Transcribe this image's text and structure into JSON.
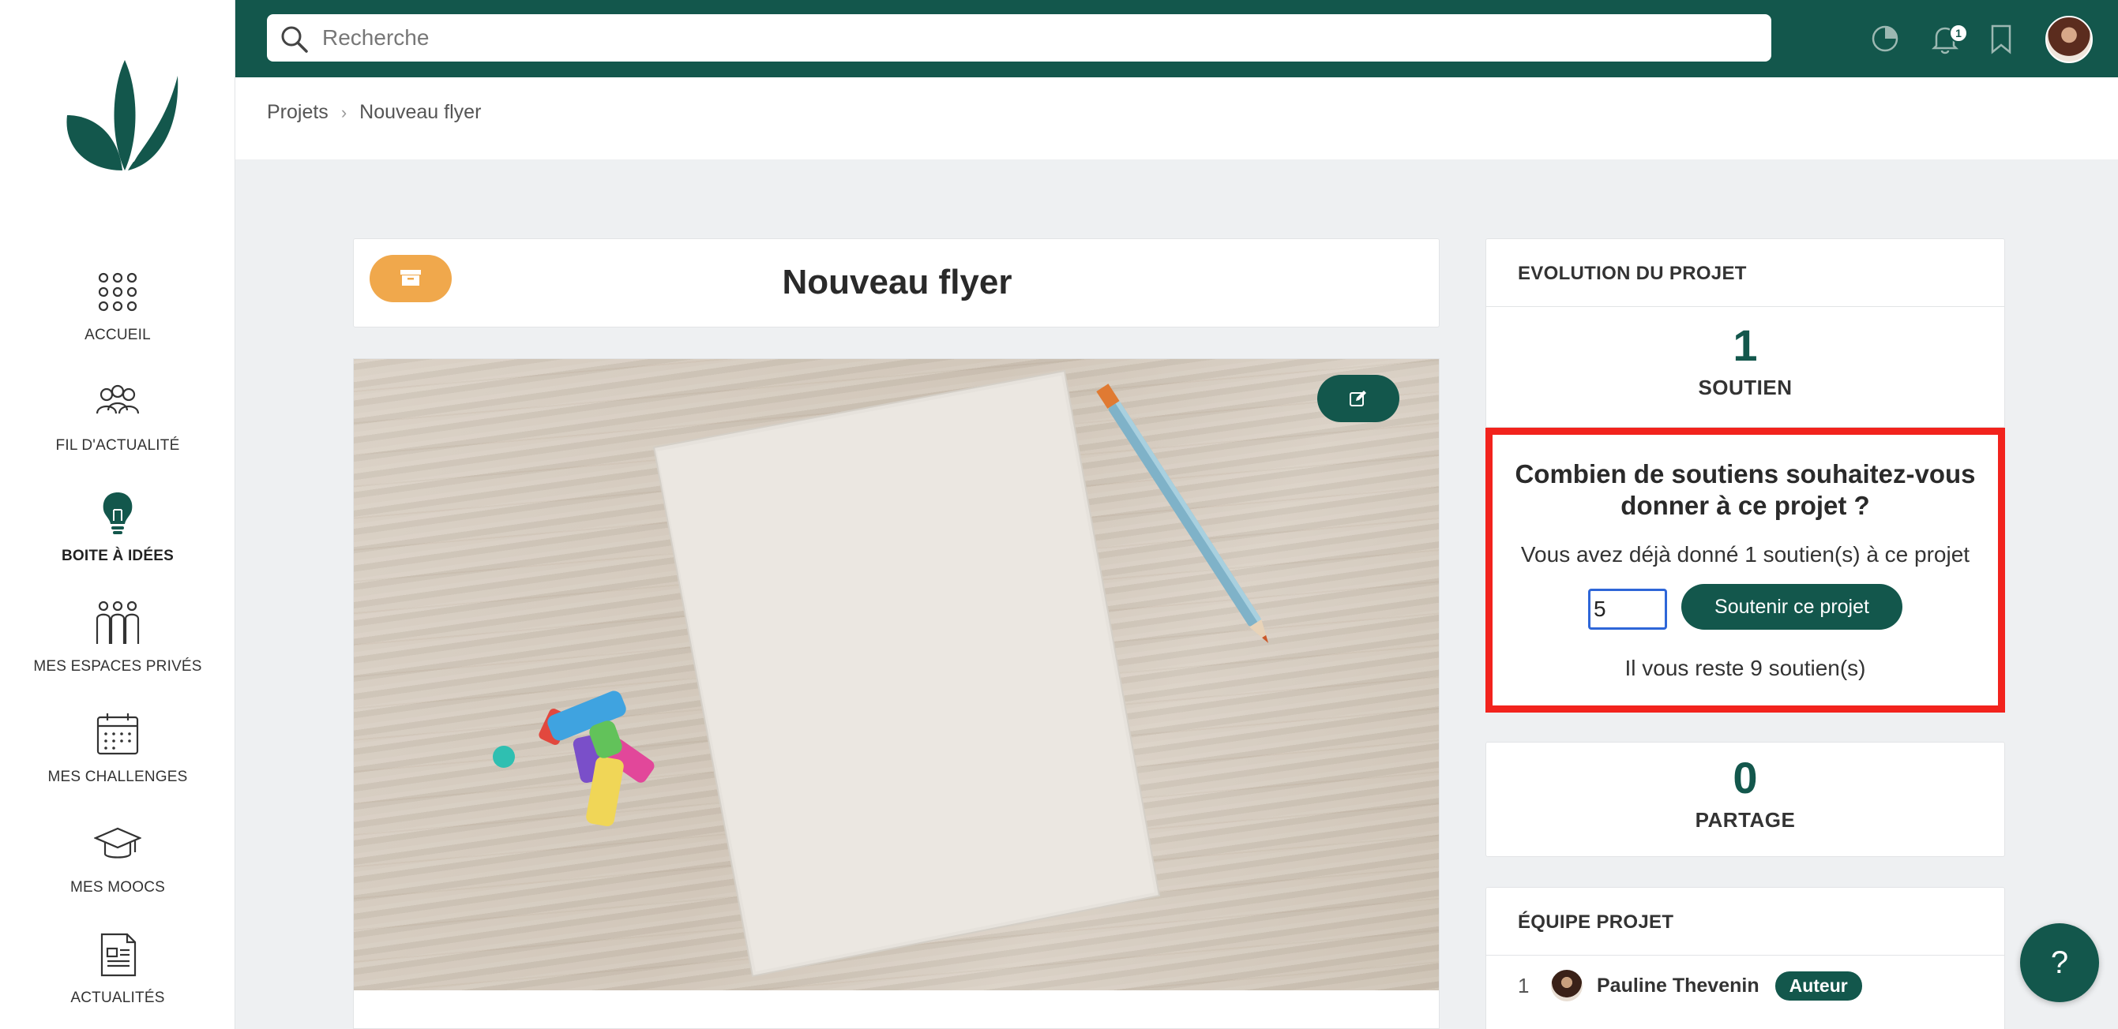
{
  "app": {
    "brand_color": "#13574c",
    "accent_orange": "#f0a84c",
    "highlight_red": "#f2231d"
  },
  "topbar": {
    "search_placeholder": "Recherche",
    "notification_count": "1",
    "icons": [
      "analytics-icon",
      "bell-icon",
      "bookmark-icon",
      "user-avatar"
    ]
  },
  "sidebar": {
    "items": [
      {
        "label": "ACCUEIL",
        "icon": "grid-dots-icon",
        "active": false
      },
      {
        "label": "FIL D'ACTUALITÉ",
        "icon": "community-icon",
        "active": false
      },
      {
        "label": "BOITE À IDÉES",
        "icon": "lightbulb-icon",
        "active": true
      },
      {
        "label": "MES ESPACES PRIVÉS",
        "icon": "group-icon",
        "active": false
      },
      {
        "label": "MES CHALLENGES",
        "icon": "calendar-icon",
        "active": false
      },
      {
        "label": "MES MOOCS",
        "icon": "graduation-cap-icon",
        "active": false
      },
      {
        "label": "ACTUALITÉS",
        "icon": "newspaper-icon",
        "active": false
      }
    ]
  },
  "breadcrumb": {
    "root": "Projets",
    "current": "Nouveau flyer"
  },
  "project": {
    "title": "Nouveau flyer"
  },
  "evolution": {
    "heading": "EVOLUTION DU PROJET",
    "supports_count": "1",
    "supports_label": "SOUTIEN",
    "shares_count": "0",
    "shares_label": "PARTAGE"
  },
  "support_form": {
    "question": "Combien de soutiens souhaitez-vous donner à ce projet ?",
    "given_text": "Vous avez déjà donné 1 soutien(s) à ce projet",
    "input_value": "5",
    "button_label": "Soutenir ce projet",
    "remaining_text": "Il vous reste 9 soutien(s)"
  },
  "team": {
    "heading": "ÉQUIPE PROJET",
    "members": [
      {
        "index": "1",
        "name": "Pauline Thevenin",
        "role": "Auteur"
      }
    ]
  },
  "help": {
    "label": "?"
  }
}
